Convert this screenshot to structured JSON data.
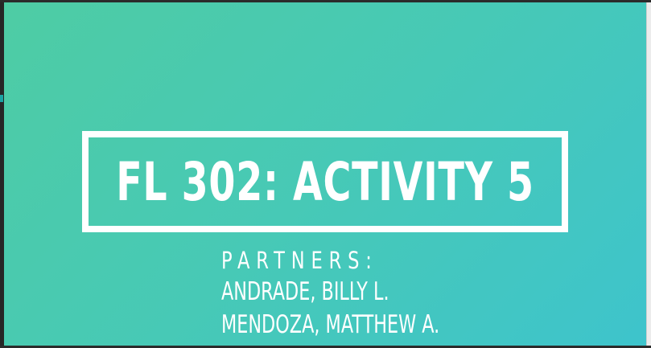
{
  "slide": {
    "title": "FL 302: ACTIVITY 5",
    "partners_label": "PARTNERS:",
    "partners": [
      "ANDRADE, BILLY L.",
      "MENDOZA, MATTHEW A."
    ],
    "background_colors": [
      "#4ecca4",
      "#3ec4cc"
    ],
    "text_color": "#ffffff"
  }
}
